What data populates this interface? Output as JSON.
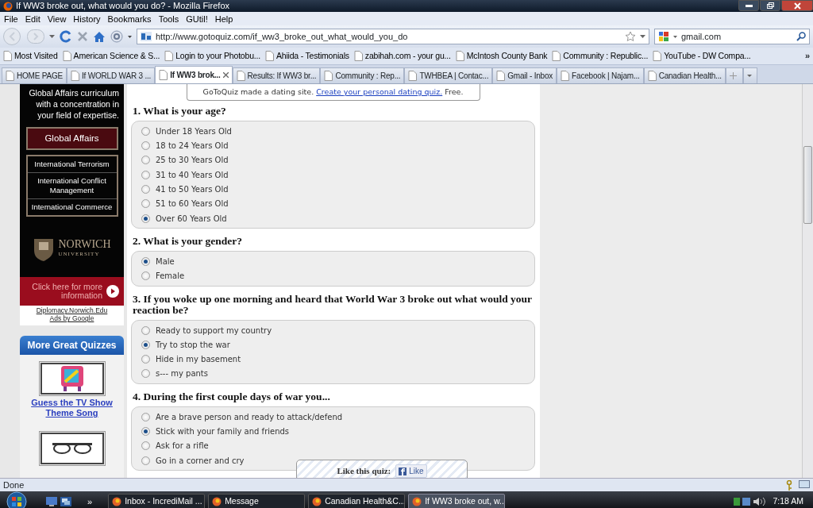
{
  "window": {
    "title": "If WW3 broke out, what would you do? - Mozilla Firefox"
  },
  "menu": [
    "File",
    "Edit",
    "View",
    "History",
    "Bookmarks",
    "Tools",
    "GUtil!",
    "Help"
  ],
  "address": {
    "value": "http://www.gotoquiz.com/if_ww3_broke_out_what_would_you_do"
  },
  "search": {
    "value": "gmail.com"
  },
  "bookmarks": [
    "Most Visited",
    "American Science & S...",
    "Login to your Photobu...",
    "Ahiida - Testimonials",
    "zabihah.com - your gu...",
    "McIntosh County Bank",
    "Community : Republic...",
    "YouTube - DW Compa..."
  ],
  "bookmarks_more": "»",
  "tabs": [
    {
      "label": "HOME PAGE",
      "selected": false
    },
    {
      "label": "If WORLD WAR 3 ...",
      "selected": false
    },
    {
      "label": "If WW3 brok...",
      "selected": true
    },
    {
      "label": "Results: If WW3 br...",
      "selected": false
    },
    {
      "label": "Community : Rep...",
      "selected": false
    },
    {
      "label": "TWHBEA | Contac...",
      "selected": false
    },
    {
      "label": "Gmail - Inbox",
      "selected": false
    },
    {
      "label": "Facebook | Najam...",
      "selected": false
    },
    {
      "label": "Canadian Health...",
      "selected": false
    }
  ],
  "ad": {
    "tagline": "Global Affairs curriculum with a concentration in your field of expertise.",
    "heading": "Global Affairs",
    "topics": [
      "International Terrorism",
      "International Conflict Management",
      "International Commerce"
    ],
    "logo_name": "NORWICH",
    "logo_sub": "UNIVERSITY",
    "cta": "Click here for more information",
    "link": "Diplomacy.Norwich.Edu",
    "ads_by": "Ads by Google"
  },
  "more_quizzes": {
    "title": "More Great Quizzes",
    "items": [
      {
        "title": "Guess the TV Show Theme Song"
      }
    ]
  },
  "notice": {
    "text": "GoToQuiz made a dating site.",
    "link": "Create your personal dating quiz.",
    "suffix": "Free."
  },
  "questions": [
    {
      "title": "1. What is your age?",
      "options": [
        {
          "label": "Under 18 Years Old",
          "selected": false
        },
        {
          "label": "18 to 24 Years Old",
          "selected": false
        },
        {
          "label": "25 to 30 Years Old",
          "selected": false
        },
        {
          "label": "31 to 40 Years Old",
          "selected": false
        },
        {
          "label": "41 to 50 Years Old",
          "selected": false
        },
        {
          "label": "51 to 60 Years Old",
          "selected": false
        },
        {
          "label": "Over 60 Years Old",
          "selected": true
        }
      ]
    },
    {
      "title": "2. What is your gender?",
      "options": [
        {
          "label": "Male",
          "selected": true
        },
        {
          "label": "Female",
          "selected": false
        }
      ]
    },
    {
      "title": "3. If you woke up one morning and heard that World War 3 broke out what would your reaction be?",
      "options": [
        {
          "label": "Ready to support my country",
          "selected": false
        },
        {
          "label": "Try to stop the war",
          "selected": true
        },
        {
          "label": "Hide in my basement",
          "selected": false
        },
        {
          "label": "s--- my pants",
          "selected": false
        }
      ]
    },
    {
      "title": "4. During the first couple days of war you...",
      "options": [
        {
          "label": "Are a brave person and ready to attack/defend",
          "selected": false
        },
        {
          "label": "Stick with your family and friends",
          "selected": true
        },
        {
          "label": "Ask for a rifle",
          "selected": false
        },
        {
          "label": "Go in a corner and cry",
          "selected": false
        }
      ]
    }
  ],
  "like_box": {
    "label": "Like this quiz:",
    "button": "Like"
  },
  "status_bar": {
    "text": "Done"
  },
  "taskbar": {
    "more": "»",
    "items": [
      {
        "label": "Inbox - IncrediMail ...",
        "selected": false
      },
      {
        "label": "Message",
        "selected": false
      },
      {
        "label": "Canadian Health&C...",
        "selected": false
      },
      {
        "label": "If WW3 broke out, w...",
        "selected": true
      }
    ],
    "clock": "7:18 AM"
  }
}
